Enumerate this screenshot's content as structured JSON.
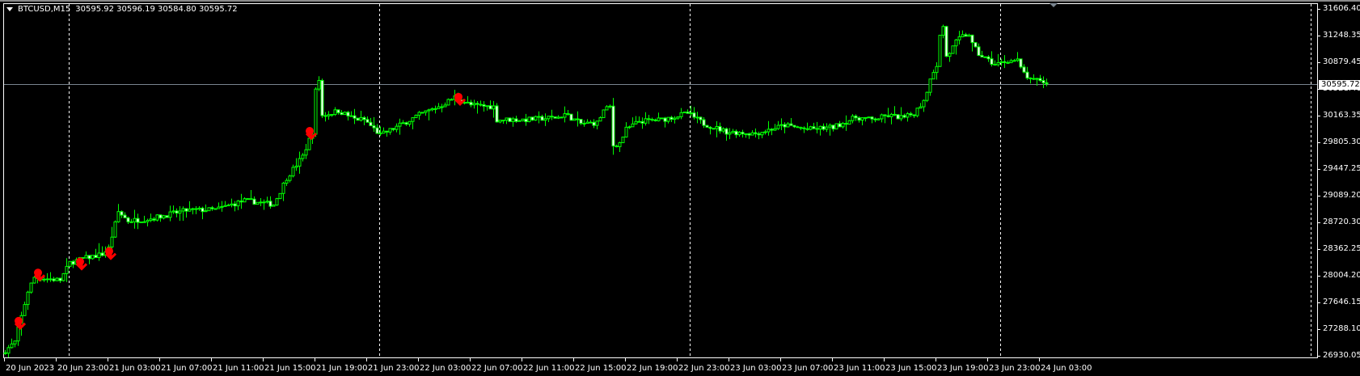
{
  "header": {
    "symbol": "BTCUSD,M15",
    "ohlc": "30595.92 30596.19 30584.80 30595.72"
  },
  "current_price": "30595.72",
  "colors": {
    "background": "#000000",
    "candle": "#00ff00",
    "bear_body": "#ffffff",
    "signal": "#ff0000",
    "price_line": "#7a8590",
    "axis": "#ffffff"
  },
  "chart_data": {
    "type": "candlestick",
    "title": "BTCUSD,M15",
    "timeframe_minutes": 15,
    "ylim": [
      26930.05,
      31606.4
    ],
    "price_ticks": [
      "31606.40",
      "31248.35",
      "30879.45",
      "30521.40",
      "30163.35",
      "29805.30",
      "29447.25",
      "29089.20",
      "28720.30",
      "28362.25",
      "28004.20",
      "27646.15",
      "27288.10",
      "26930.05"
    ],
    "time_ticks": [
      "20 Jun 2023",
      "20 Jun 23:00",
      "21 Jun 03:00",
      "21 Jun 07:00",
      "21 Jun 11:00",
      "21 Jun 15:00",
      "21 Jun 19:00",
      "21 Jun 23:00",
      "22 Jun 03:00",
      "22 Jun 07:00",
      "22 Jun 11:00",
      "22 Jun 15:00",
      "22 Jun 19:00",
      "22 Jun 23:00",
      "23 Jun 03:00",
      "23 Jun 07:00",
      "23 Jun 11:00",
      "23 Jun 15:00",
      "23 Jun 19:00",
      "23 Jun 23:00",
      "24 Jun 03:00"
    ],
    "bars_per_tick": 16,
    "close_anchors": [
      [
        0,
        27000
      ],
      [
        3,
        27115
      ],
      [
        7,
        27802
      ],
      [
        9,
        27987
      ],
      [
        14,
        27965
      ],
      [
        17,
        27950
      ],
      [
        20,
        28184
      ],
      [
        24,
        28240
      ],
      [
        30,
        28300
      ],
      [
        32,
        28380
      ],
      [
        35,
        28870
      ],
      [
        38,
        28750
      ],
      [
        45,
        28780
      ],
      [
        56,
        28890
      ],
      [
        65,
        28900
      ],
      [
        74,
        29023
      ],
      [
        83,
        28970
      ],
      [
        87,
        29328
      ],
      [
        92,
        29622
      ],
      [
        95,
        29950
      ],
      [
        96,
        30500
      ],
      [
        97,
        30650
      ],
      [
        98,
        30168
      ],
      [
        103,
        30233
      ],
      [
        108,
        30124
      ],
      [
        111,
        30113
      ],
      [
        116,
        29906
      ],
      [
        121,
        30015
      ],
      [
        128,
        30178
      ],
      [
        135,
        30309
      ],
      [
        139,
        30418
      ],
      [
        144,
        30309
      ],
      [
        151,
        30287
      ],
      [
        152,
        30113
      ],
      [
        161,
        30113
      ],
      [
        171,
        30146
      ],
      [
        173,
        30190
      ],
      [
        178,
        30059
      ],
      [
        183,
        30070
      ],
      [
        185,
        30233
      ],
      [
        187,
        30287
      ],
      [
        188,
        29764
      ],
      [
        190,
        29797
      ],
      [
        192,
        29982
      ],
      [
        196,
        30091
      ],
      [
        203,
        30113
      ],
      [
        208,
        30168
      ],
      [
        211,
        30200
      ],
      [
        216,
        30059
      ],
      [
        223,
        29950
      ],
      [
        232,
        29928
      ],
      [
        241,
        30037
      ],
      [
        248,
        29982
      ],
      [
        256,
        30010
      ],
      [
        263,
        30146
      ],
      [
        268,
        30113
      ],
      [
        273,
        30168
      ],
      [
        278,
        30140
      ],
      [
        281,
        30200
      ],
      [
        283,
        30309
      ],
      [
        285,
        30473
      ],
      [
        286,
        30690
      ],
      [
        288,
        30854
      ],
      [
        289,
        31236
      ],
      [
        290,
        31377
      ],
      [
        291,
        30963
      ],
      [
        292,
        31018
      ],
      [
        294,
        31160
      ],
      [
        296,
        31236
      ],
      [
        298,
        31268
      ],
      [
        299,
        31127
      ],
      [
        301,
        30996
      ],
      [
        303,
        30941
      ],
      [
        306,
        30854
      ],
      [
        310,
        30909
      ],
      [
        313,
        30909
      ],
      [
        314,
        30800
      ],
      [
        316,
        30690
      ],
      [
        317,
        30636
      ],
      [
        320,
        30650
      ],
      [
        322,
        30595.72
      ]
    ],
    "signals": [
      {
        "bar": 4,
        "price": 27400,
        "type": "sell"
      },
      {
        "bar": 10,
        "price": 28050,
        "type": "sell"
      },
      {
        "bar": 23,
        "price": 28200,
        "type": "sell"
      },
      {
        "bar": 32,
        "price": 28340,
        "type": "sell"
      },
      {
        "bar": 94,
        "price": 29960,
        "type": "sell"
      },
      {
        "bar": 140,
        "price": 30420,
        "type": "sell"
      }
    ]
  }
}
